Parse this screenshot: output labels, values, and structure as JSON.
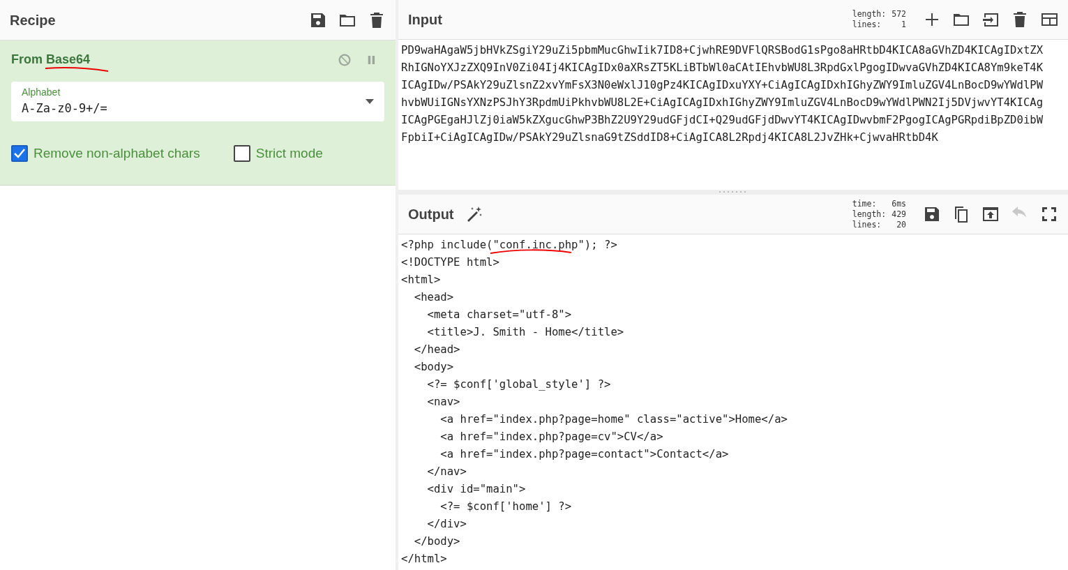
{
  "recipe": {
    "title": "Recipe",
    "tools": [
      {
        "kind": "save",
        "disabled": false
      },
      {
        "kind": "folder",
        "disabled": false
      },
      {
        "kind": "trash",
        "disabled": false
      }
    ]
  },
  "operation": {
    "name": "From Base64",
    "underlined": true,
    "controls": [
      {
        "kind": "disable",
        "disabled": false
      },
      {
        "kind": "pause",
        "disabled": false
      }
    ],
    "alphabet": {
      "label": "Alphabet",
      "value": "A-Za-z0-9+/="
    },
    "options": [
      {
        "label": "Remove non-alphabet chars",
        "checked": true
      },
      {
        "label": "Strict mode",
        "checked": false
      }
    ]
  },
  "input": {
    "title": "Input",
    "stats": [
      {
        "label": "length:",
        "value": "572"
      },
      {
        "label": "lines:",
        "value": "1"
      }
    ],
    "tools": [
      {
        "kind": "plus",
        "disabled": false
      },
      {
        "kind": "folder",
        "disabled": false
      },
      {
        "kind": "enter",
        "disabled": false
      },
      {
        "kind": "trash",
        "disabled": false
      },
      {
        "kind": "layout",
        "disabled": false
      }
    ],
    "lines": [
      "PD9waHAgaW5jbHVkZSgiY29uZi5pbmMucGhwIik7ID8+CjwhRE9DVFlQRSBodG1sPgo8aHRtbD4KICA8aGVhZD4KICAgIDxtZX",
      "RhIGNoYXJzZXQ9InV0Zi04Ij4KICAgIDx0aXRsZT5KLiBTbWl0aCAtIEhvbWU8L3RpdGxlPgogIDwvaGVhZD4KICA8Ym9keT4K",
      "ICAgIDw/PSAkY29uZlsnZ2xvYmFsX3N0eWxlJ10gPz4KICAgIDxuYXY+CiAgICAgIDxhIGhyZWY9ImluZGV4LnBocD9wYWdlPW",
      "hvbWUiIGNsYXNzPSJhY3RpdmUiPkhvbWU8L2E+CiAgICAgIDxhIGhyZWY9ImluZGV4LnBocD9wYWdlPWN2Ij5DVjwvYT4KICAg",
      "ICAgPGEgaHJlZj0iaW5kZXgucGhwP3BhZ2U9Y29udGFjdCI+Q29udGFjdDwvYT4KICAgIDwvbmF2PgogICAgPGRpdiBpZD0ibW",
      "FpbiI+CiAgICAgIDw/PSAkY29uZlsnaG9tZSddID8+CiAgICA8L2Rpdj4KICA8L2JvZHk+CjwvaHRtbD4K"
    ]
  },
  "output": {
    "title": "Output",
    "stats": [
      {
        "label": "time:",
        "value": "6ms"
      },
      {
        "label": "length:",
        "value": "429"
      },
      {
        "label": "lines:",
        "value": "20"
      }
    ],
    "tools": [
      {
        "kind": "save",
        "disabled": false
      },
      {
        "kind": "copy",
        "disabled": false
      },
      {
        "kind": "upload",
        "disabled": false
      },
      {
        "kind": "undo",
        "disabled": true
      },
      {
        "kind": "fullscreen",
        "disabled": false
      }
    ],
    "lines": [
      {
        "text": "<?php include(\"conf.inc.php\"); ?>",
        "underlined": true
      },
      {
        "text": "<!DOCTYPE html>",
        "underlined": false
      },
      {
        "text": "<html>",
        "underlined": false
      },
      {
        "text": "  <head>",
        "underlined": false
      },
      {
        "text": "    <meta charset=\"utf-8\">",
        "underlined": false
      },
      {
        "text": "    <title>J. Smith - Home</title>",
        "underlined": false
      },
      {
        "text": "  </head>",
        "underlined": false
      },
      {
        "text": "  <body>",
        "underlined": false
      },
      {
        "text": "    <?= $conf['global_style'] ?>",
        "underlined": false
      },
      {
        "text": "    <nav>",
        "underlined": false
      },
      {
        "text": "      <a href=\"index.php?page=home\" class=\"active\">Home</a>",
        "underlined": false
      },
      {
        "text": "      <a href=\"index.php?page=cv\">CV</a>",
        "underlined": false
      },
      {
        "text": "      <a href=\"index.php?page=contact\">Contact</a>",
        "underlined": false
      },
      {
        "text": "    </nav>",
        "underlined": false
      },
      {
        "text": "    <div id=\"main\">",
        "underlined": false
      },
      {
        "text": "      <?= $conf['home'] ?>",
        "underlined": false
      },
      {
        "text": "    </div>",
        "underlined": false
      },
      {
        "text": "  </body>",
        "underlined": false
      },
      {
        "text": "</html>",
        "underlined": false
      }
    ]
  }
}
